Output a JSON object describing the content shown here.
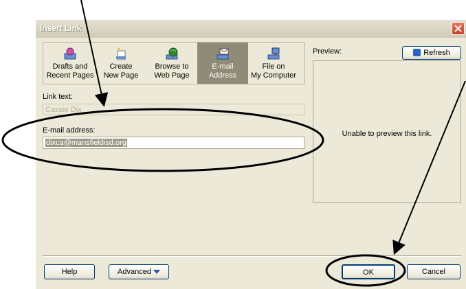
{
  "dialog": {
    "title": "Insert Link",
    "tabs": [
      {
        "line1": "Drafts and",
        "line2": "Recent Pages",
        "icon": "drafts-icon"
      },
      {
        "line1": "Create",
        "line2": "New Page",
        "icon": "new-page-icon"
      },
      {
        "line1": "Browse to",
        "line2": "Web Page",
        "icon": "globe-icon"
      },
      {
        "line1": "E-mail",
        "line2": "Address",
        "icon": "email-icon",
        "selected": true
      },
      {
        "line1": "File on",
        "line2": "My Computer",
        "icon": "computer-icon"
      }
    ],
    "link_text_label": "Link text:",
    "link_text_value": "Cassie Dix",
    "email_label": "E-mail address:",
    "email_value": "dixca@mansfieldisd.org",
    "preview_label": "Preview:",
    "refresh_label": "Refresh",
    "preview_message": "Unable to preview this link.",
    "help_label": "Help",
    "advanced_label": "Advanced",
    "ok_label": "OK",
    "cancel_label": "Cancel"
  },
  "colors": {
    "dialog_bg": "#ece9d8",
    "selected_tab": "#8f8b76",
    "annotation": "#000000",
    "close_button": "#d0502f"
  }
}
